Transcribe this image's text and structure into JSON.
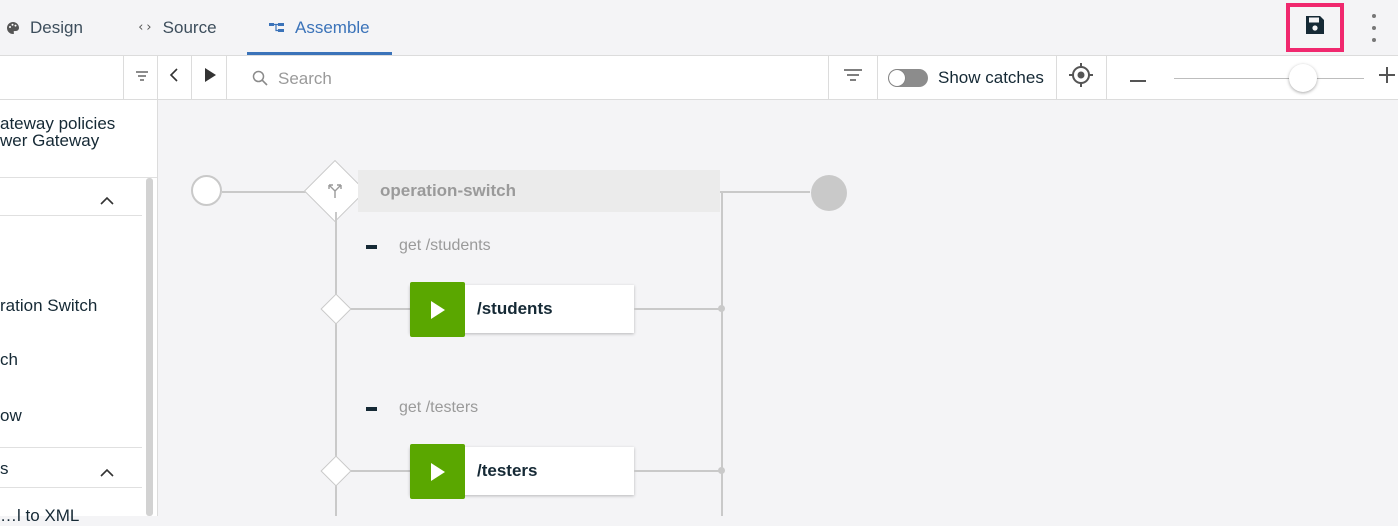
{
  "tabs": [
    {
      "label": "Design",
      "icon": "palette-icon"
    },
    {
      "label": "Source",
      "icon": "code-icon"
    },
    {
      "label": "Assemble",
      "icon": "assemble-icon",
      "active": true
    }
  ],
  "toolbar": {
    "search_placeholder": "Search",
    "show_catches_label": "Show catches",
    "show_catches_on": false,
    "zoom_level": 0.68
  },
  "left_panel": {
    "header_line1": "ateway policies",
    "header_line2": "wer Gateway",
    "section1_items": [
      "ration Switch",
      "ch",
      "ow"
    ],
    "section2_title": "s",
    "section2_partial_item": "…l to XML"
  },
  "flow": {
    "switch_label": "operation-switch",
    "cases": [
      {
        "condition": "get /students",
        "node_label": "/students"
      },
      {
        "condition": "get /testers",
        "node_label": "/testers"
      }
    ]
  },
  "colors": {
    "accent": "#3b73b9",
    "highlight": "#f0286e",
    "invoke_green": "#5aa700"
  }
}
